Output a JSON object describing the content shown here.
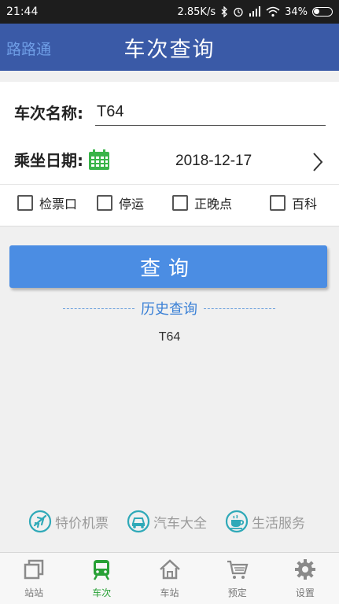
{
  "status_bar": {
    "time": "21:44",
    "network_speed": "2.85K/s",
    "battery_percent": "34%"
  },
  "header": {
    "brand": "路路通",
    "title": "车次查询"
  },
  "form": {
    "train_label": "车次名称:",
    "train_value": "T64",
    "date_label": "乘坐日期:",
    "date_value": "2018-12-17",
    "options": [
      {
        "label": "检票口",
        "checked": false
      },
      {
        "label": "停运",
        "checked": false
      },
      {
        "label": "正晚点",
        "checked": false
      },
      {
        "label": "百科",
        "checked": false
      }
    ]
  },
  "query_button": "查询",
  "history": {
    "title": "历史查询",
    "items": [
      "T64"
    ]
  },
  "services": [
    {
      "label": "特价机票",
      "icon": "airplane-icon"
    },
    {
      "label": "汽车大全",
      "icon": "car-icon"
    },
    {
      "label": "生活服务",
      "icon": "coffee-cup-icon"
    }
  ],
  "tabbar": {
    "active_index": 1,
    "tabs": [
      {
        "label": "站站",
        "icon": "station-to-station-icon"
      },
      {
        "label": "车次",
        "icon": "train-icon"
      },
      {
        "label": "车站",
        "icon": "station-house-icon"
      },
      {
        "label": "预定",
        "icon": "shopping-cart-icon"
      },
      {
        "label": "设置",
        "icon": "gear-icon"
      }
    ]
  },
  "colors": {
    "header_bg": "#3a5aa7",
    "brand_text": "#6f9ee6",
    "button_bg": "#4b8de3",
    "history_accent": "#3a80d6",
    "active_tab": "#27a035",
    "calendar_green": "#39b449"
  }
}
